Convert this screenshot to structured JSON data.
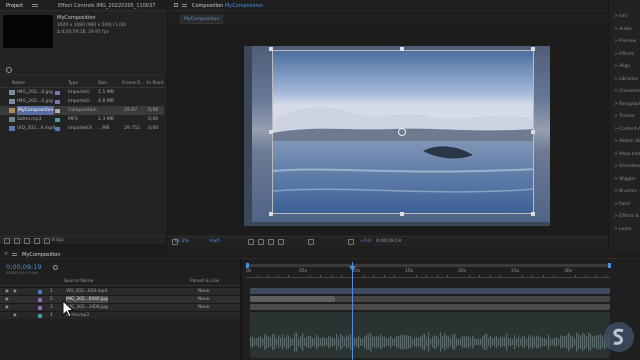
{
  "effect_controls_tab": {
    "project_label": "Project",
    "effect_label": "Effect Controls IMG_20220205_110037"
  },
  "project_panel": {
    "comp_name": "MyComposition",
    "comp_info": "1920 x 1080 (960 x 540) (1.00)",
    "comp_duration": "Δ 0;00;59;18, 29.97 fps",
    "search_icon": "search-icon",
    "columns": [
      "Name",
      "",
      "Type",
      "Size",
      "Frame R...",
      "In Point"
    ],
    "items": [
      {
        "name": "IMG_202...0.jpg",
        "type": "ImporteG",
        "size": "1.5 MB",
        "fps": "",
        "in": "",
        "color": "#8b6fb8"
      },
      {
        "name": "IMG_202...0.jpg",
        "type": "ImporteG",
        "size": "4.8 MB",
        "fps": "",
        "in": "",
        "color": "#8b6fb8"
      },
      {
        "name": "MyComposition",
        "type": "Composition",
        "size": "",
        "fps": "29.97",
        "in": "0;00",
        "color": "#b0b0b0",
        "selected": true
      },
      {
        "name": "Salmi.mp3",
        "type": "MP3",
        "size": "1.3 MB",
        "fps": "",
        "in": "0;00",
        "color": "#3fa0a0"
      },
      {
        "name": "VID_202...4.mp4",
        "type": "ImporteEX",
        "size": "...MB",
        "fps": "29.752",
        "in": "0;00",
        "color": "#4b7fc4"
      }
    ],
    "bpc": "8 bpc"
  },
  "composition_panel": {
    "tab_label": "Composition",
    "tab_comp": "MyComposition",
    "breadcrumb": "MyComposition",
    "zoom": "33.3%",
    "resolution": "Half",
    "timecode": "0;00;09;19",
    "exposure": "+0.0"
  },
  "timeline": {
    "tab_label": "MyComposition",
    "timecode": "0;00;09;19",
    "timecode_sub": "00289 (29.97 fps)",
    "col_source": "Source Name",
    "col_parent": "Parent & Link",
    "ticks": [
      "0s",
      "05s",
      "10s",
      "15s",
      "20s",
      "25s",
      "30s"
    ],
    "layers": [
      {
        "num": "1",
        "name": "VID_202...624.mp4",
        "parent": "None",
        "color": "#4b7fc4"
      },
      {
        "num": "2",
        "name": "IMG_202...0440.jpg",
        "parent": "None",
        "color": "#8b6fb8"
      },
      {
        "num": "3",
        "name": "IMG_202...3408.jpg",
        "parent": "None",
        "color": "#8b6fb8"
      },
      {
        "num": "4",
        "name": "Salmi.mp3",
        "parent": "None",
        "color": "#3fa0a0"
      }
    ]
  },
  "right_panel_items": [
    "Info",
    "Audio",
    "Preview",
    "Effects",
    "Align",
    "Libraries",
    "Character",
    "Paragraph",
    "Tracker",
    "Content-Aware Fill",
    "Motion Sketch",
    "Mask Interpolation",
    "Smoother",
    "Wiggler",
    "Brushes",
    "Paint",
    "Effects & Presets",
    "Learn"
  ]
}
